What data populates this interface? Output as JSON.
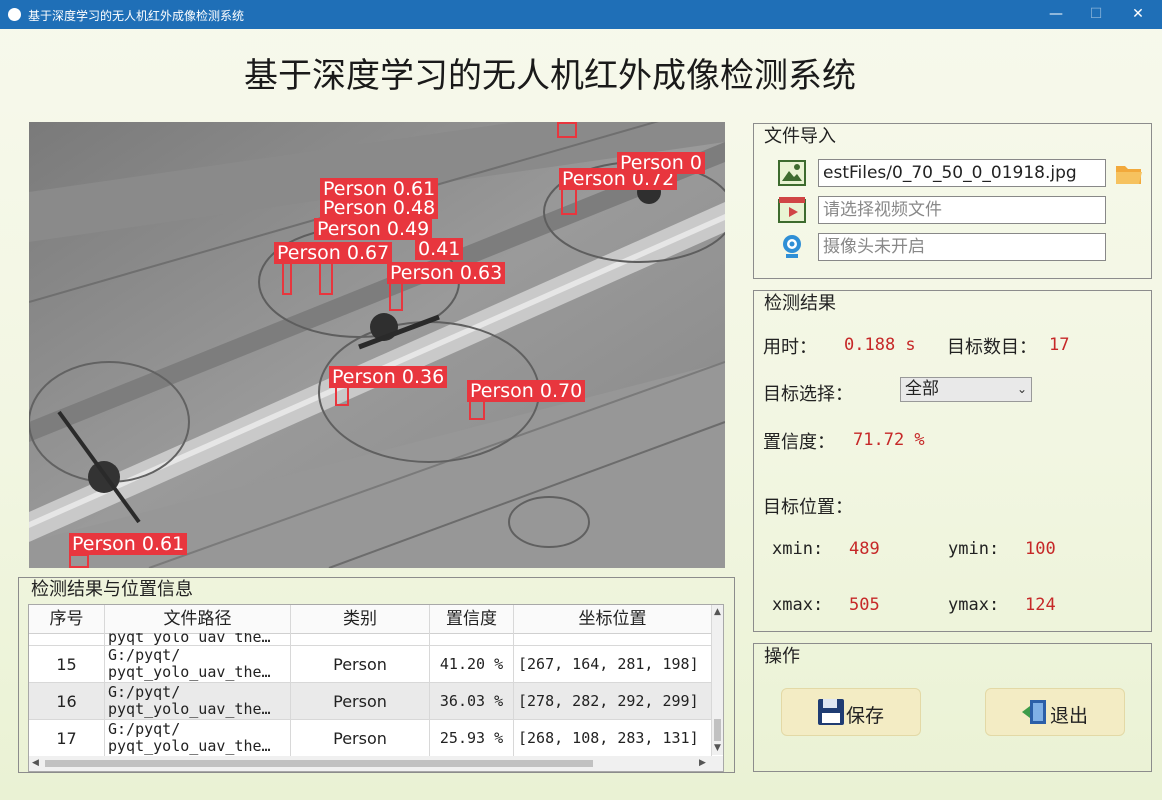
{
  "window": {
    "title": "基于深度学习的无人机红外成像检测系统"
  },
  "heading": "基于深度学习的无人机红外成像检测系统",
  "detections": [
    {
      "label": "Person 0.61"
    },
    {
      "label": "Person 0.48"
    },
    {
      "label": "Person 0.49"
    },
    {
      "label": "Person 0.67"
    },
    {
      "label": "0.41"
    },
    {
      "label": "Person 0.63"
    },
    {
      "label": "Person 0.72"
    },
    {
      "label": "Person 0"
    },
    {
      "label": "Person 0.36"
    },
    {
      "label": "Person 0.70"
    },
    {
      "label": "Person 0.61"
    }
  ],
  "file_import": {
    "title": "文件导入",
    "image_path": "estFiles/0_70_50_0_01918.jpg",
    "video_placeholder": "请选择视频文件",
    "camera_placeholder": "摄像头未开启"
  },
  "results": {
    "title": "检测结果",
    "time_label": "用时：",
    "time_value": "0.188 s",
    "count_label": "目标数目：",
    "count_value": "17",
    "select_label": "目标选择：",
    "select_value": "全部",
    "conf_label": "置信度：",
    "conf_value": "71.72 %",
    "position_label": "目标位置：",
    "xmin_label": "xmin:",
    "xmin_value": "489",
    "ymin_label": "ymin:",
    "ymin_value": "100",
    "xmax_label": "xmax:",
    "xmax_value": "505",
    "ymax_label": "ymax:",
    "ymax_value": "124"
  },
  "actions": {
    "title": "操作",
    "save_label": "保存",
    "exit_label": "退出"
  },
  "table": {
    "title": "检测结果与位置信息",
    "columns": [
      "序号",
      "文件路径",
      "类别",
      "置信度",
      "坐标位置"
    ],
    "rows": [
      {
        "index": "15",
        "path1": "G:/pyqt/",
        "path2": "pyqt_yolo_uav_the…",
        "cls": "Person",
        "conf": "41.20 %",
        "coord": "[267, 164, 281, 198]"
      },
      {
        "index": "16",
        "path1": "G:/pyqt/",
        "path2": "pyqt_yolo_uav_the…",
        "cls": "Person",
        "conf": "36.03 %",
        "coord": "[278, 282, 292, 299]"
      },
      {
        "index": "17",
        "path1": "G:/pyqt/",
        "path2": "pyqt_yolo_uav_the…",
        "cls": "Person",
        "conf": "25.93 %",
        "coord": "[268, 108, 283, 131]"
      }
    ],
    "partial_row_path": "pyqt_yolo_uav_the…"
  },
  "icons": {
    "image_icon": "image-file-icon",
    "video_icon": "video-file-icon",
    "camera_icon": "webcam-icon",
    "folder_icon": "folder-open-icon",
    "save_icon": "floppy-disk-icon",
    "exit_icon": "exit-door-icon"
  },
  "colors": {
    "accent_red": "#e8363e",
    "value_red": "#c62828",
    "titlebar_blue": "#1f6fb7"
  }
}
